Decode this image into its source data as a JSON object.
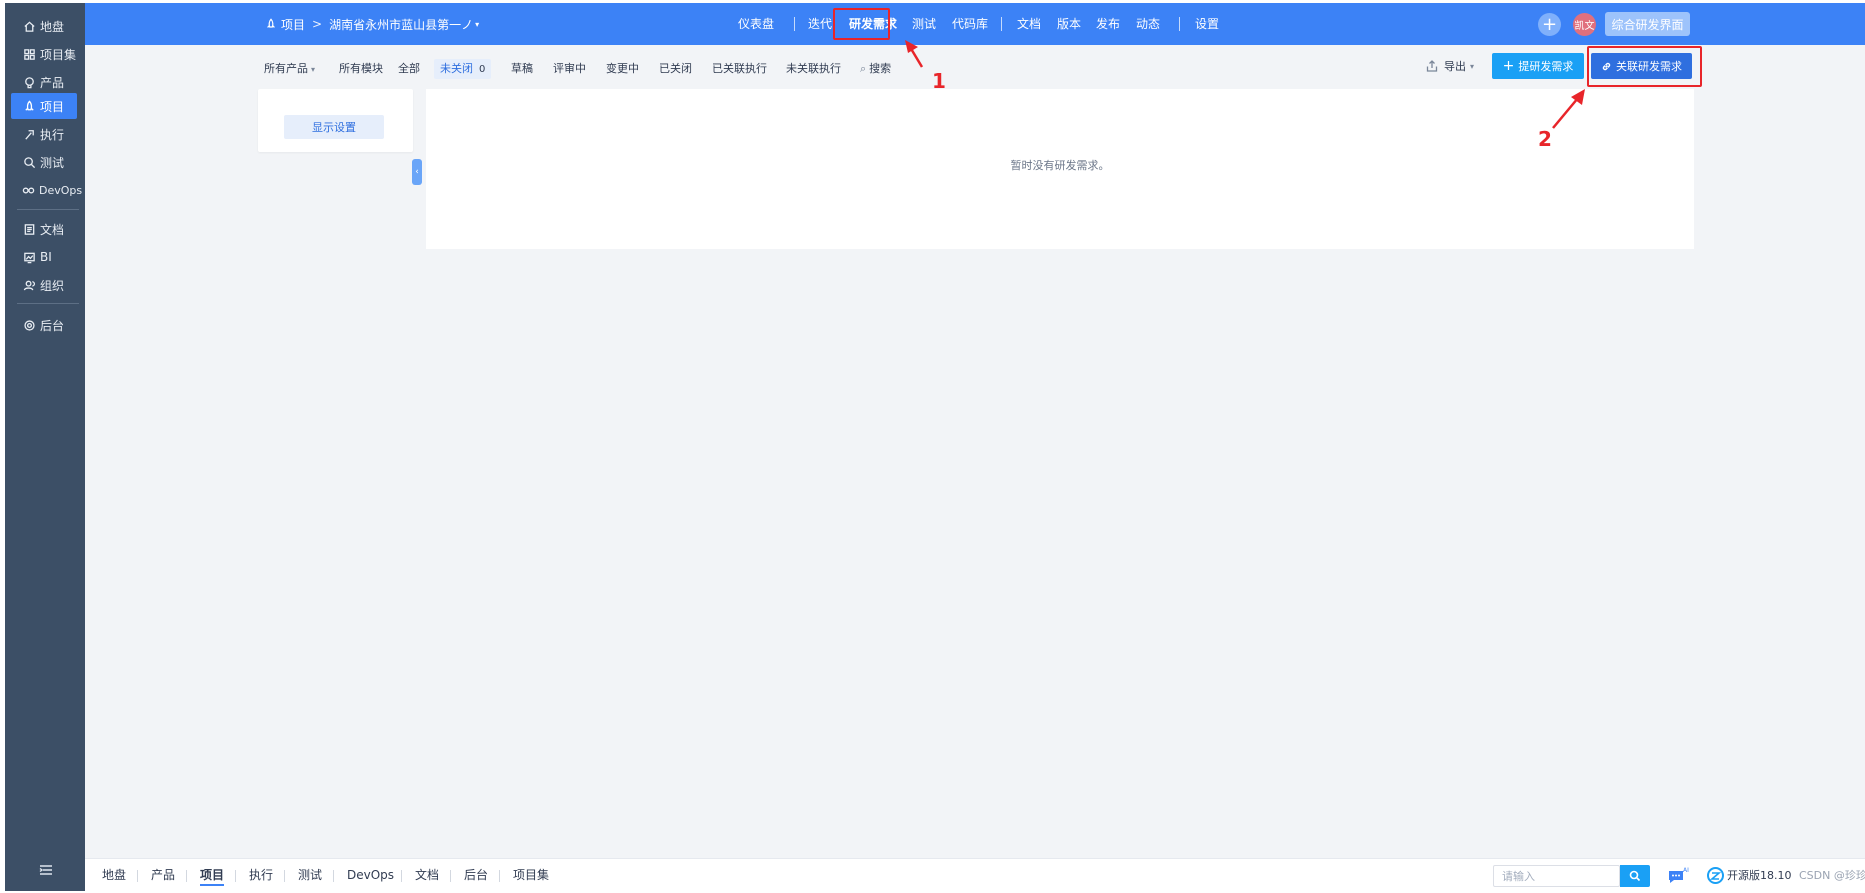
{
  "sidebar": {
    "items": [
      {
        "label": "地盘",
        "icon": "home-icon"
      },
      {
        "label": "项目集",
        "icon": "grid-icon"
      },
      {
        "label": "产品",
        "icon": "lightbulb-icon"
      },
      {
        "label": "项目",
        "icon": "project-icon"
      },
      {
        "label": "执行",
        "icon": "run-icon"
      },
      {
        "label": "测试",
        "icon": "test-icon"
      },
      {
        "label": "DevOps",
        "icon": "infinity-icon"
      },
      {
        "label": "文档",
        "icon": "document-icon"
      },
      {
        "label": "BI",
        "icon": "chart-icon"
      },
      {
        "label": "组织",
        "icon": "users-icon"
      },
      {
        "label": "后台",
        "icon": "gear-icon"
      }
    ],
    "active": "项目"
  },
  "header": {
    "crumb_project": "项目",
    "crumb_current": "湖南省永州市蓝山县第一ノ",
    "nav": [
      "仪表盘",
      "迭代",
      "研发需求",
      "测试",
      "代码库",
      "文档",
      "版本",
      "发布",
      "动态",
      "设置"
    ],
    "active_nav": "研发需求",
    "avatar_text": "凯文",
    "ui_switch": "综合研发界面"
  },
  "filters": {
    "all_products": "所有产品",
    "all_modules": "所有模块",
    "tabs": [
      "全部",
      "未关闭",
      "草稿",
      "评审中",
      "变更中",
      "已关闭",
      "已关联执行",
      "未关联执行"
    ],
    "active_tab": "未关闭",
    "active_count": "0",
    "search": "搜索"
  },
  "toolbar": {
    "export": "导出",
    "create": "提研发需求",
    "link": "关联研发需求"
  },
  "left_panel": {
    "display_settings": "显示设置"
  },
  "main": {
    "empty": "暂时没有研发需求。"
  },
  "annotations": {
    "one": "1",
    "two": "2"
  },
  "footer": {
    "items": [
      "地盘",
      "产品",
      "项目",
      "执行",
      "测试",
      "DevOps",
      "文档",
      "后台",
      "项目集"
    ],
    "active": "项目",
    "search_placeholder": "请输入",
    "version": "开源版18.10",
    "watermark": "CSDN @珍珍哥"
  },
  "colors": {
    "sidebar": "#3c4f66",
    "primary": "#3c82f6",
    "highlight": "#e8252a"
  }
}
